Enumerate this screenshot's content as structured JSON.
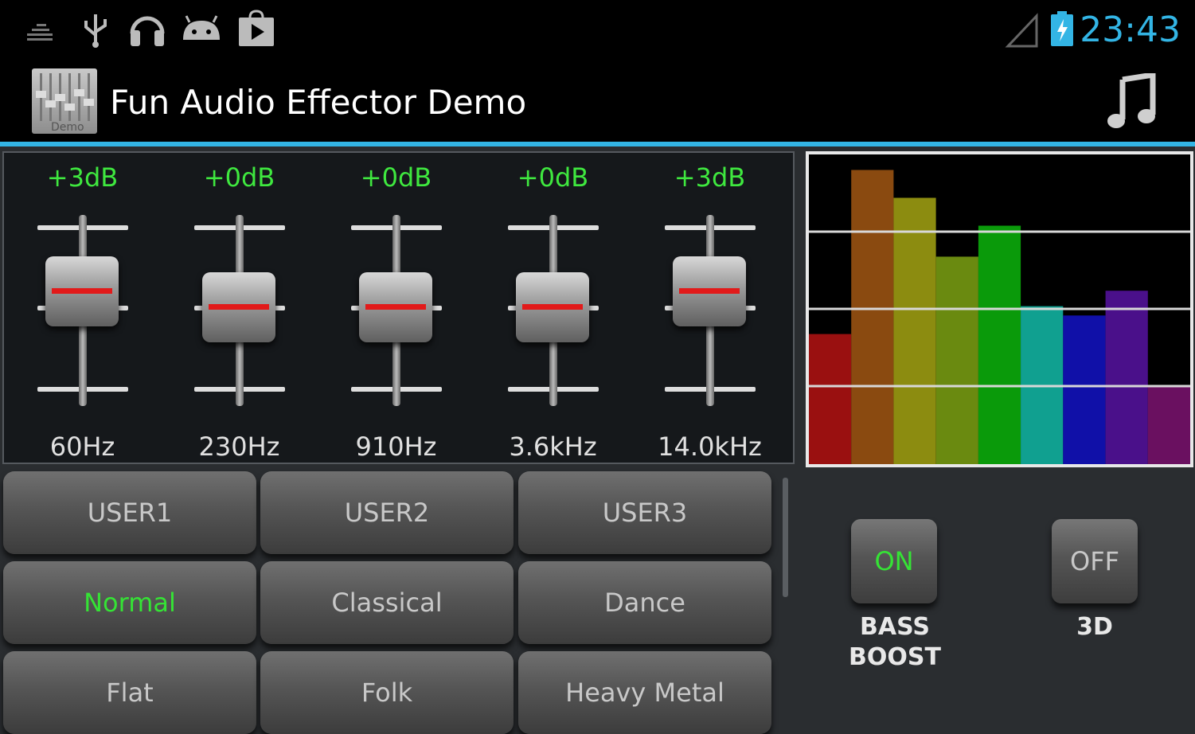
{
  "status_bar": {
    "time": "23:43",
    "icons": [
      "equalizer-notification-icon",
      "usb-icon",
      "headphones-icon",
      "android-icon",
      "play-store-icon",
      "signal-icon",
      "battery-charging-icon"
    ]
  },
  "action_bar": {
    "app_icon_text": "Demo",
    "title": "Fun Audio Effector Demo",
    "action_icon": "music-note-icon"
  },
  "equalizer": {
    "bands": [
      {
        "gain": "+3dB",
        "freq": "60Hz",
        "level_db": 3
      },
      {
        "gain": "+0dB",
        "freq": "230Hz",
        "level_db": 0
      },
      {
        "gain": "+0dB",
        "freq": "910Hz",
        "level_db": 0
      },
      {
        "gain": "+0dB",
        "freq": "3.6kHz",
        "level_db": 0
      },
      {
        "gain": "+3dB",
        "freq": "14.0kHz",
        "level_db": 3
      }
    ]
  },
  "spectrum": {
    "levels": [
      0.42,
      0.95,
      0.86,
      0.67,
      0.77,
      0.51,
      0.48,
      0.56,
      0.25
    ],
    "colors": [
      "#9a1010",
      "#8a4a10",
      "#8c8c10",
      "#6a8a10",
      "#0a9a0a",
      "#10a090",
      "#1010a8",
      "#4a108a",
      "#6a1060"
    ]
  },
  "presets": [
    {
      "label": "USER1",
      "active": false
    },
    {
      "label": "USER2",
      "active": false
    },
    {
      "label": "USER3",
      "active": false
    },
    {
      "label": "Normal",
      "active": true
    },
    {
      "label": "Classical",
      "active": false
    },
    {
      "label": "Dance",
      "active": false
    },
    {
      "label": "Flat",
      "active": false
    },
    {
      "label": "Folk",
      "active": false
    },
    {
      "label": "Heavy Metal",
      "active": false
    }
  ],
  "bass_boost": {
    "state": "ON",
    "label_line1": "BASS",
    "label_line2": "BOOST",
    "on_color": "#35e335"
  },
  "surround_3d": {
    "state": "OFF",
    "label": "3D",
    "off_color": "#c8c8c8"
  }
}
